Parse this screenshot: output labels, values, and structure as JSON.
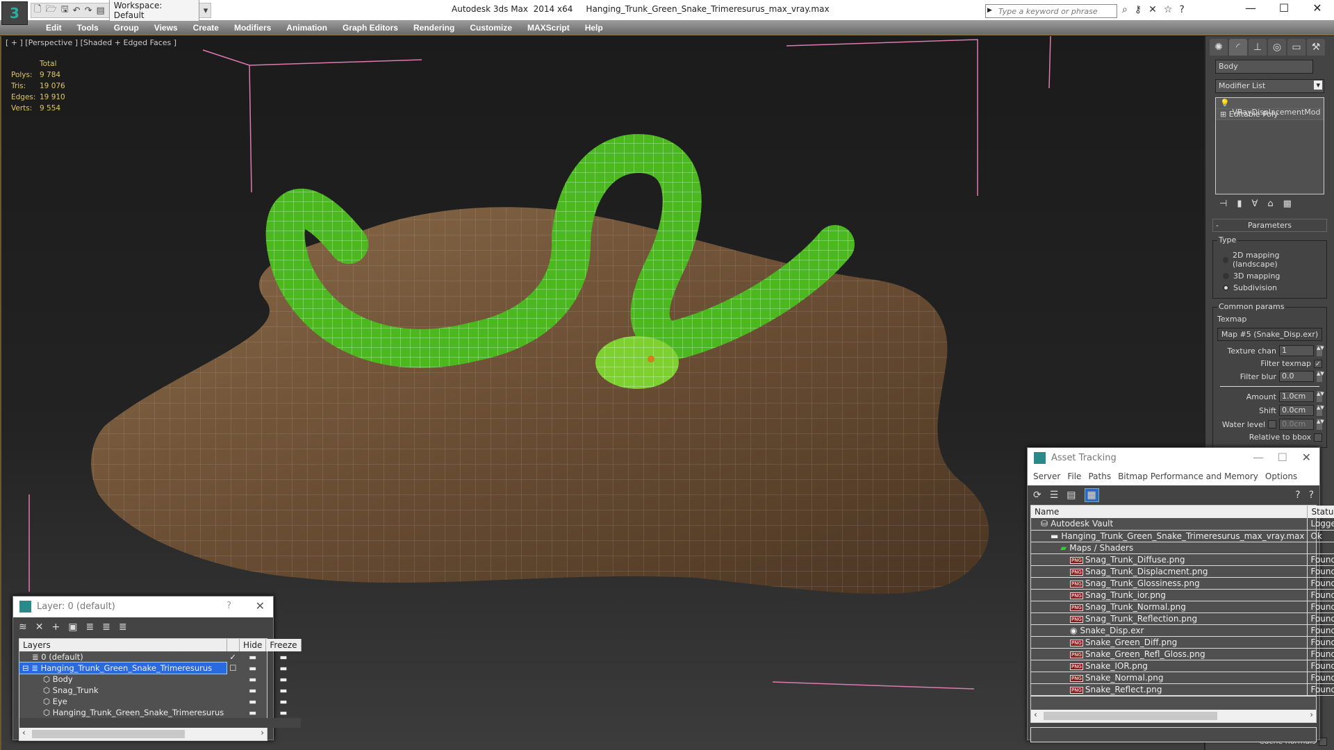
{
  "app": {
    "title": "Autodesk 3ds Max  2014 x64     Hanging_Trunk_Green_Snake_Trimeresurus_max_vray.max",
    "workspace": "Workspace: Default",
    "search_placeholder": "Type a keyword or phrase"
  },
  "menu": [
    "Edit",
    "Tools",
    "Group",
    "Views",
    "Create",
    "Modifiers",
    "Animation",
    "Graph Editors",
    "Rendering",
    "Customize",
    "MAXScript",
    "Help"
  ],
  "viewport": {
    "label": "[ + ] [Perspective ] [Shaded + Edged Faces ]",
    "stats": {
      "header": "Total",
      "rows": [
        {
          "k": "Polys:",
          "v": "9 784"
        },
        {
          "k": "Tris:",
          "v": "19 076"
        },
        {
          "k": "Edges:",
          "v": "19 910"
        },
        {
          "k": "Verts:",
          "v": "9 554"
        }
      ]
    }
  },
  "command_panel": {
    "object_name": "Body",
    "modifier_list": "Modifier List",
    "stack": [
      "VRayDisplacementMod",
      "Editable Poly"
    ],
    "rollout": "Parameters",
    "type_label": "Type",
    "types": [
      "2D mapping (landscape)",
      "3D mapping",
      "Subdivision"
    ],
    "common": "Common params",
    "texmap_label": "Texmap",
    "texmap": "Map #5 (Snake_Disp.exr)",
    "params": [
      {
        "k": "Texture chan",
        "v": "1"
      },
      {
        "k": "Filter blur",
        "v": "0.0"
      },
      {
        "k": "Amount",
        "v": "1.0cm"
      },
      {
        "k": "Shift",
        "v": "0.0cm"
      }
    ],
    "filter_texmap": "Filter texmap",
    "water_level": "Water level",
    "water_value": "0.0cm",
    "relative_bbox": "Relative to bbox",
    "cache_normals": "Cache normals"
  },
  "layer_dialog": {
    "title": "Layer: 0 (default)",
    "help": "?",
    "cols": [
      "Layers",
      "Hide",
      "Freeze"
    ],
    "rows": [
      "0 (default)",
      "Hanging_Trunk_Green_Snake_Trimeresurus",
      "Body",
      "Snag_Trunk",
      "Eye",
      "Hanging_Trunk_Green_Snake_Trimeresurus"
    ]
  },
  "asset_tracking": {
    "title": "Asset Tracking",
    "menu": [
      "Server",
      "File",
      "Paths",
      "Bitmap Performance and Memory",
      "Options"
    ],
    "cols": [
      "Name",
      "Status"
    ],
    "rows": [
      {
        "name": "Autodesk Vault",
        "status": "Logged",
        "level": 1,
        "icon": "vault"
      },
      {
        "name": "Hanging_Trunk_Green_Snake_Trimeresurus_max_vray.max",
        "status": "Ok",
        "level": 2,
        "icon": "max"
      },
      {
        "name": "Maps / Shaders",
        "status": "",
        "level": 3,
        "icon": "maps"
      },
      {
        "name": "Snag_Trunk_Diffuse.png",
        "status": "Found",
        "level": 4,
        "icon": "png"
      },
      {
        "name": "Snag_Trunk_Displacment.png",
        "status": "Found",
        "level": 4,
        "icon": "png"
      },
      {
        "name": "Snag_Trunk_Glossiness.png",
        "status": "Found",
        "level": 4,
        "icon": "png"
      },
      {
        "name": "Snag_Trunk_ior.png",
        "status": "Found",
        "level": 4,
        "icon": "png"
      },
      {
        "name": "Snag_Trunk_Normal.png",
        "status": "Found",
        "level": 4,
        "icon": "png"
      },
      {
        "name": "Snag_Trunk_Reflection.png",
        "status": "Found",
        "level": 4,
        "icon": "png"
      },
      {
        "name": "Snake_Disp.exr",
        "status": "Found",
        "level": 4,
        "icon": "exr"
      },
      {
        "name": "Snake_Green_Diff.png",
        "status": "Found",
        "level": 4,
        "icon": "png"
      },
      {
        "name": "Snake_Green_Refl_Gloss.png",
        "status": "Found",
        "level": 4,
        "icon": "png"
      },
      {
        "name": "Snake_IOR.png",
        "status": "Found",
        "level": 4,
        "icon": "png"
      },
      {
        "name": "Snake_Normal.png",
        "status": "Found",
        "level": 4,
        "icon": "png"
      },
      {
        "name": "Snake_Reflect.png",
        "status": "Found",
        "level": 4,
        "icon": "png"
      }
    ]
  }
}
